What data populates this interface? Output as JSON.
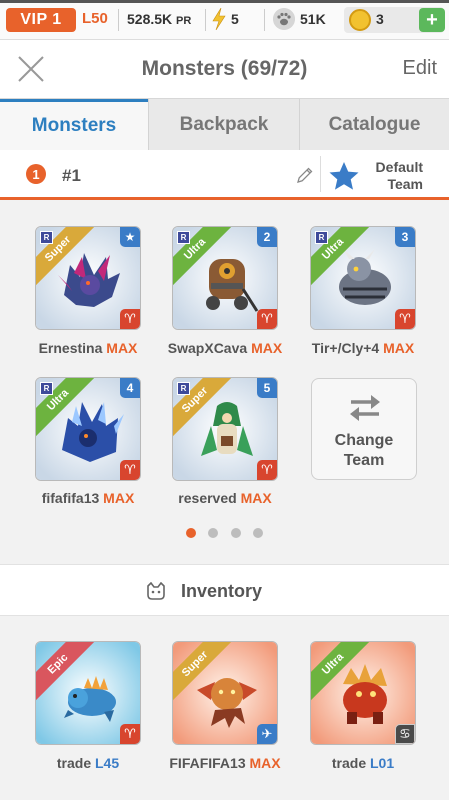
{
  "status": {
    "vip": "VIP 1",
    "level": "L50",
    "power_value": "528.5K",
    "power_unit": "PR",
    "energy": "5",
    "paws": "51K",
    "coins": "3",
    "add": "+"
  },
  "header": {
    "title": "Monsters (69/72)",
    "edit": "Edit"
  },
  "tabs": [
    {
      "label": "Monsters",
      "active": true
    },
    {
      "label": "Backpack",
      "active": false
    },
    {
      "label": "Catalogue",
      "active": false
    }
  ],
  "team": {
    "number": "1",
    "label": "#1",
    "default_line1": "Default",
    "default_line2": "Team"
  },
  "team_monsters": [
    {
      "name": "Ernestina",
      "tag": "MAX",
      "rarity": "Super",
      "slot": "★",
      "element": "♈"
    },
    {
      "name": "SwapXCava",
      "tag": "MAX",
      "rarity": "Ultra",
      "slot": "2",
      "element": "♈"
    },
    {
      "name": "Tir+/Cly+4",
      "tag": "MAX",
      "rarity": "Ultra",
      "slot": "3",
      "element": "♈"
    },
    {
      "name": "fifafifa13",
      "tag": "MAX",
      "rarity": "Ultra",
      "slot": "4",
      "element": "♈"
    },
    {
      "name": "reserved",
      "tag": "MAX",
      "rarity": "Super",
      "slot": "5",
      "element": "♈"
    }
  ],
  "rank_badge": "R",
  "change_team": {
    "line1": "Change",
    "line2": "Team"
  },
  "pager": {
    "pages": 4,
    "current": 1
  },
  "inventory": {
    "label": "Inventory",
    "items": [
      {
        "name": "trade",
        "tag": "L45",
        "rarity": "Epic",
        "element": "♈"
      },
      {
        "name": "FIFAFIFA13",
        "tag": "MAX",
        "rarity": "Super",
        "element": "✈"
      },
      {
        "name": "trade",
        "tag": "L01",
        "rarity": "Ultra",
        "element": "♋"
      }
    ]
  },
  "colors": {
    "accent": "#e8622b",
    "tab_active": "#2d7fc0",
    "ultra": "#6db33f",
    "super": "#d9a93a",
    "epic": "#d9565e",
    "slot": "#3a7cc7",
    "element": "#d8452e"
  }
}
